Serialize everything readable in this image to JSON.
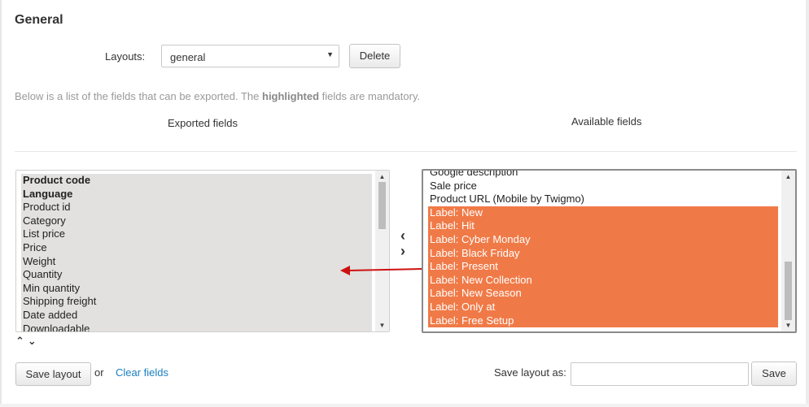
{
  "section": {
    "title": "General"
  },
  "layouts": {
    "label": "Layouts:",
    "selected": "general",
    "delete_label": "Delete"
  },
  "help": {
    "before": "Below is a list of the fields that can be exported. The ",
    "highlight": "highlighted",
    "after": " fields are mandatory."
  },
  "columns": {
    "exported_title": "Exported fields",
    "available_title": "Available fields"
  },
  "exported_fields": [
    {
      "label": "Product code",
      "mandatory": true
    },
    {
      "label": "Language",
      "mandatory": true
    },
    {
      "label": "Product id",
      "mandatory": false
    },
    {
      "label": "Category",
      "mandatory": false
    },
    {
      "label": "List price",
      "mandatory": false
    },
    {
      "label": "Price",
      "mandatory": false
    },
    {
      "label": "Weight",
      "mandatory": false
    },
    {
      "label": "Quantity",
      "mandatory": false
    },
    {
      "label": "Min quantity",
      "mandatory": false
    },
    {
      "label": "Shipping freight",
      "mandatory": false
    },
    {
      "label": "Date added",
      "mandatory": false
    },
    {
      "label": "Downloadable",
      "mandatory": false
    }
  ],
  "available_fields": [
    {
      "label": "Google description",
      "selected": false
    },
    {
      "label": "Sale price",
      "selected": false
    },
    {
      "label": "Product URL (Mobile by Twigmo)",
      "selected": false
    },
    {
      "label": "Label: New",
      "selected": true
    },
    {
      "label": "Label: Hit",
      "selected": true
    },
    {
      "label": "Label: Cyber Monday",
      "selected": true
    },
    {
      "label": "Label: Black Friday",
      "selected": true
    },
    {
      "label": "Label: Present",
      "selected": true
    },
    {
      "label": "Label: New Collection",
      "selected": true
    },
    {
      "label": "Label: New Season",
      "selected": true
    },
    {
      "label": "Label: Only at",
      "selected": true
    },
    {
      "label": "Label: Free Setup",
      "selected": true
    }
  ],
  "controls": {
    "move_left_icon": "chevron-left-icon",
    "move_right_icon": "chevron-right-icon",
    "move_up_icon": "chevron-up-icon",
    "move_down_icon": "chevron-down-icon"
  },
  "footer": {
    "save_layout_label": "Save layout",
    "or_text": "or",
    "clear_fields_label": "Clear fields",
    "save_as_label": "Save layout as:",
    "save_as_value": "",
    "save_label": "Save"
  },
  "colors": {
    "selected_bg": "#f07a47",
    "mandatory_bg": "#e2e1df",
    "link": "#1a7fc1",
    "annotation_arrow": "#cc1111"
  }
}
